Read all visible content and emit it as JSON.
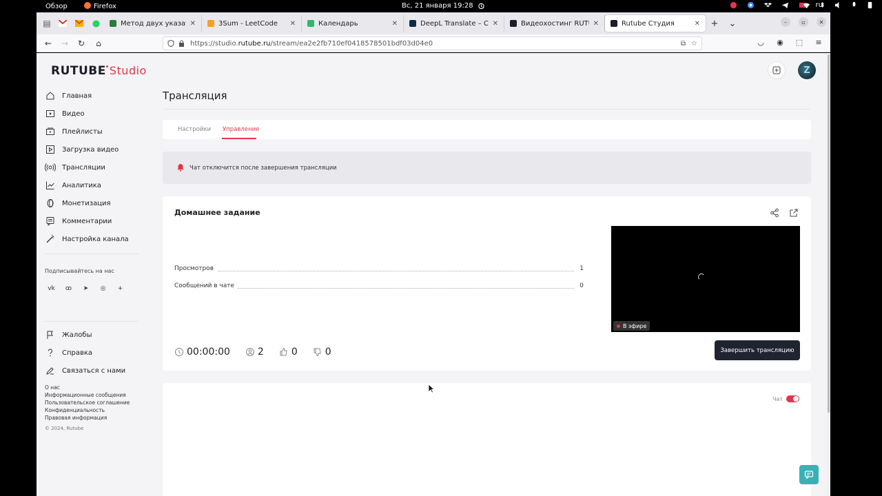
{
  "system_bar": {
    "overview": "Обзор",
    "app": "Firefox",
    "datetime": "Вс, 21 января  19:28",
    "lang": "ru"
  },
  "browser": {
    "tabs": [
      {
        "label": "Метод двух указателе",
        "color": "#2b7d3a"
      },
      {
        "label": "3Sum - LeetCode",
        "color": "#f89f1b"
      },
      {
        "label": "Календарь",
        "color": "#2fb86b"
      },
      {
        "label": "DeepL Translate – Сам",
        "color": "#0f2b46"
      },
      {
        "label": "Видеохостинг RUTUBE",
        "color": "#1c1c2a"
      },
      {
        "label": "Rutube Студия",
        "color": "#1c1c2a"
      }
    ],
    "url_prefix": "https://studio.",
    "url_host": "rutube.ru",
    "url_path": "/stream/ea2e2fb710ef0418578501bdf03d04e0"
  },
  "sidebar": {
    "logo_main": "RUTUBE",
    "logo_studio": "Studio",
    "items": [
      {
        "label": "Главная",
        "icon": "home-icon"
      },
      {
        "label": "Видео",
        "icon": "video-icon"
      },
      {
        "label": "Плейлисты",
        "icon": "playlist-icon"
      },
      {
        "label": "Загрузка видео",
        "icon": "upload-icon"
      },
      {
        "label": "Трансляции",
        "icon": "broadcast-icon"
      },
      {
        "label": "Аналитика",
        "icon": "analytics-icon"
      },
      {
        "label": "Монетизация",
        "icon": "coin-icon"
      },
      {
        "label": "Комментарии",
        "icon": "comments-icon"
      },
      {
        "label": "Настройка канала",
        "icon": "wand-icon"
      }
    ],
    "follow_label": "Подписывайтесь на нас",
    "bottom_items": [
      {
        "label": "Жалобы",
        "icon": "flag-icon"
      },
      {
        "label": "Справка",
        "icon": "help-icon"
      },
      {
        "label": "Связаться с нами",
        "icon": "pencil-icon"
      }
    ],
    "footer_links": [
      "О нас",
      "Информационные сообщения",
      "Пользовательское соглашение",
      "Конфиденциальность",
      "Правовая информация"
    ],
    "copyright": "© 2024, Rutube"
  },
  "main": {
    "title": "Трансляция",
    "tabs": [
      {
        "label": "Настройки"
      },
      {
        "label": "Управление"
      }
    ],
    "alert": "Чат отключится после завершения трансляции",
    "stream_name": "Домашнее задание",
    "stats": [
      {
        "label": "Просмотров",
        "value": "1"
      },
      {
        "label": "Сообщений в чате",
        "value": "0"
      }
    ],
    "duration": "00:00:00",
    "viewers": "2",
    "likes": "0",
    "dislikes": "0",
    "live_label": "В эфире",
    "end_button": "Завершить трансляцию",
    "chat_label": "Чат",
    "chat_enabled": true
  },
  "colors": {
    "accent": "#e5334b",
    "button_dark": "#1f2430",
    "float_chat": "#3ab0b5"
  }
}
